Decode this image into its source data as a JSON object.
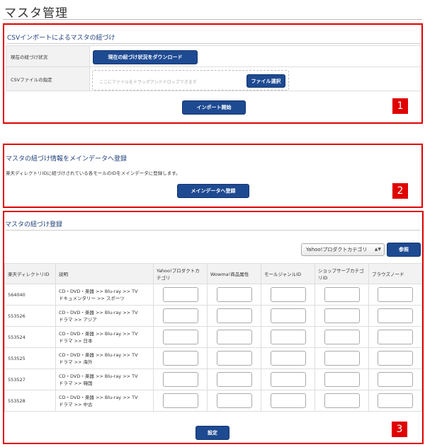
{
  "page": {
    "title": "マスタ管理"
  },
  "section1": {
    "number": "1",
    "title": "CSVインポートによるマスタの紐づけ",
    "status_label": "現在の紐づけ状況",
    "download_button": "現在の紐づけ状況をダウンロード",
    "file_label": "CSVファイルの指定",
    "dropzone_placeholder": "ここにファイルをドラッグアンドドロップできます",
    "file_select_button": "ファイル選択",
    "import_button": "インポート開始"
  },
  "section2": {
    "number": "2",
    "title": "マスタの紐づけ情報をメインデータへ登録",
    "description": "楽天ディレクトリIDに紐づけされている各モールのIDをメインデータに登録します。",
    "register_button": "メインデータへ登録"
  },
  "section3": {
    "number": "3",
    "title": "マスタの紐づけ登録",
    "select_value": "Yahoo!プロダクトカテゴリ",
    "reference_button": "参照",
    "columns": [
      "楽天ディレクトリID",
      "説明",
      "Yahoo!プロダクトカテゴリ",
      "Wowma!商品属性",
      "モールジャンルID",
      "ショップサーブカテゴリID",
      "ブラウズノード"
    ],
    "rows": [
      {
        "id": "564040",
        "desc1": "CD・DVD・楽器 >> Blu-ray >> TV",
        "desc2": "ドキュメンタリー >> スポーツ"
      },
      {
        "id": "553526",
        "desc1": "CD・DVD・楽器 >> Blu-ray >> TV",
        "desc2": "ドラマ >> アジア"
      },
      {
        "id": "553524",
        "desc1": "CD・DVD・楽器 >> Blu-ray >> TV",
        "desc2": "ドラマ >> 日本"
      },
      {
        "id": "553525",
        "desc1": "CD・DVD・楽器 >> Blu-ray >> TV",
        "desc2": "ドラマ >> 海外"
      },
      {
        "id": "553527",
        "desc1": "CD・DVD・楽器 >> Blu-ray >> TV",
        "desc2": "ドラマ >> 韓国"
      },
      {
        "id": "553528",
        "desc1": "CD・DVD・楽器 >> Blu-ray >> TV",
        "desc2": "ドラマ >> 中古"
      }
    ],
    "submit_button": "設定"
  },
  "colors": {
    "highlight": "#e00000",
    "button": "#1e4a92",
    "title_text": "#1f3f7a"
  }
}
